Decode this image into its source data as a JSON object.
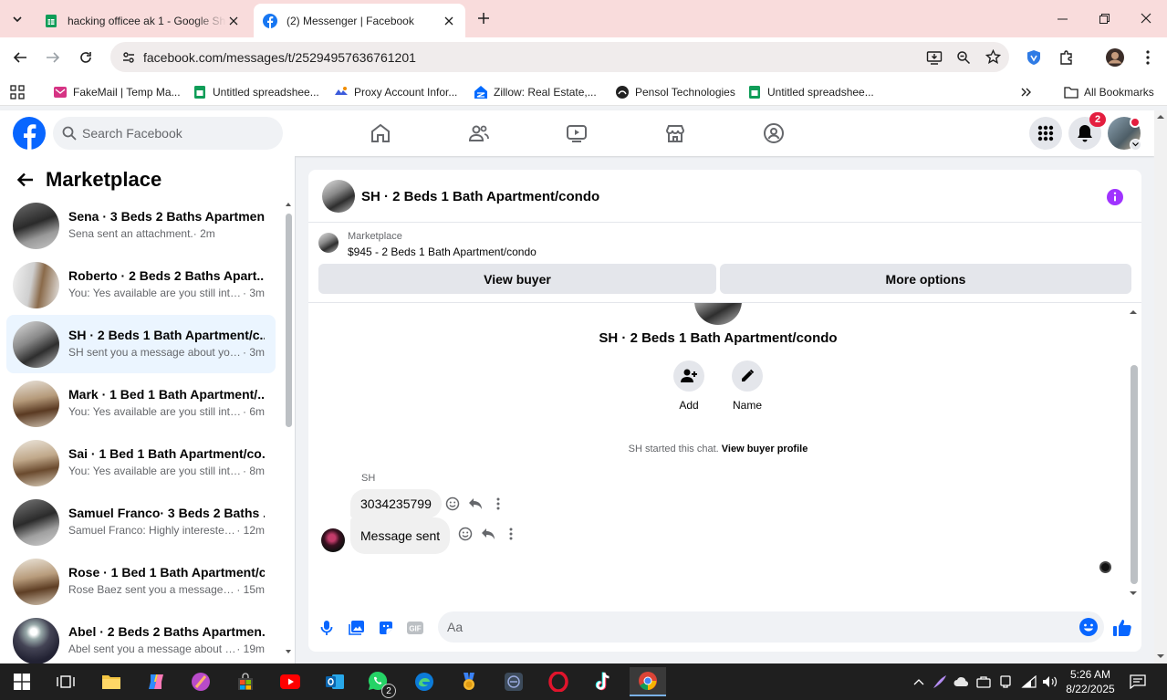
{
  "browser": {
    "tabs": [
      {
        "title": "hacking officee ak 1 - Google Sh",
        "favicon": "google-sheets-icon",
        "active": false
      },
      {
        "title": "(2) Messenger | Facebook",
        "favicon": "facebook-icon",
        "active": true
      }
    ],
    "url": "facebook.com/messages/t/25294957636761201"
  },
  "bookmarks": [
    {
      "label": "FakeMail | Temp Ma...",
      "icon": "fakemail-icon"
    },
    {
      "label": "Untitled spreadshee...",
      "icon": "google-sheets-icon"
    },
    {
      "label": "Proxy Account Infor...",
      "icon": "proxy-icon"
    },
    {
      "label": "Zillow: Real Estate,...",
      "icon": "zillow-icon"
    },
    {
      "label": "Pensol Technologies",
      "icon": "pensol-icon"
    },
    {
      "label": "Untitled spreadshee...",
      "icon": "google-sheets-icon"
    }
  ],
  "all_bookmarks": "All Bookmarks",
  "facebook": {
    "search_placeholder": "Search Facebook",
    "notification_count": "2"
  },
  "sidebar": {
    "title": "Marketplace",
    "conversations": [
      {
        "name": "Sena · 3 Beds 2 Baths Apartmen...",
        "snippet": "Sena sent an attachment.",
        "time": " · 2m",
        "selected": false
      },
      {
        "name": "Roberto · 2 Beds 2 Baths Apart...",
        "snippet": "You: Yes available are you still inter...",
        "time": " · 3m",
        "selected": false
      },
      {
        "name": "SH · 2 Beds 1 Bath Apartment/c...",
        "snippet": "SH sent you a message about you...",
        "time": " · 3m",
        "selected": true
      },
      {
        "name": "Mark · 1 Bed 1 Bath Apartment/...",
        "snippet": "You: Yes available are you still inter...",
        "time": " · 6m",
        "selected": false
      },
      {
        "name": "Sai · 1 Bed 1 Bath Apartment/co...",
        "snippet": "You: Yes available are you still inter...",
        "time": " · 8m",
        "selected": false
      },
      {
        "name": "Samuel Franco· 3 Beds 2 Baths ...",
        "snippet": "Samuel Franco: Highly interested...",
        "time": " · 12m",
        "selected": false
      },
      {
        "name": "Rose · 1 Bed 1 Bath Apartment/c...",
        "snippet": "Rose Baez sent you a message a...",
        "time": " · 15m",
        "selected": false
      },
      {
        "name": "Abel · 2 Beds 2 Baths Apartmen...",
        "snippet": "Abel sent you a message about y...",
        "time": " · 19m",
        "selected": false
      }
    ]
  },
  "chat": {
    "title": "SH · 2 Beds 1 Bath Apartment/condo",
    "marketplace_label": "Marketplace",
    "listing": "$945 - 2 Beds 1 Bath Apartment/condo",
    "view_buyer": "View buyer",
    "more_options": "More options",
    "profile_name": "SH · 2 Beds 1 Bath Apartment/condo",
    "actions": {
      "add": "Add",
      "name": "Name"
    },
    "started_text": "SH started this chat.",
    "view_buyer_profile": "View buyer profile",
    "sender": "SH",
    "messages": [
      {
        "text": "3034235799",
        "from": "SH"
      },
      {
        "text": "Message sent",
        "from": "me"
      }
    ],
    "composer_placeholder": "Aa"
  },
  "taskbar": {
    "time": "5:26 AM",
    "date": "8/22/2025",
    "whatsapp_badge": "2"
  }
}
